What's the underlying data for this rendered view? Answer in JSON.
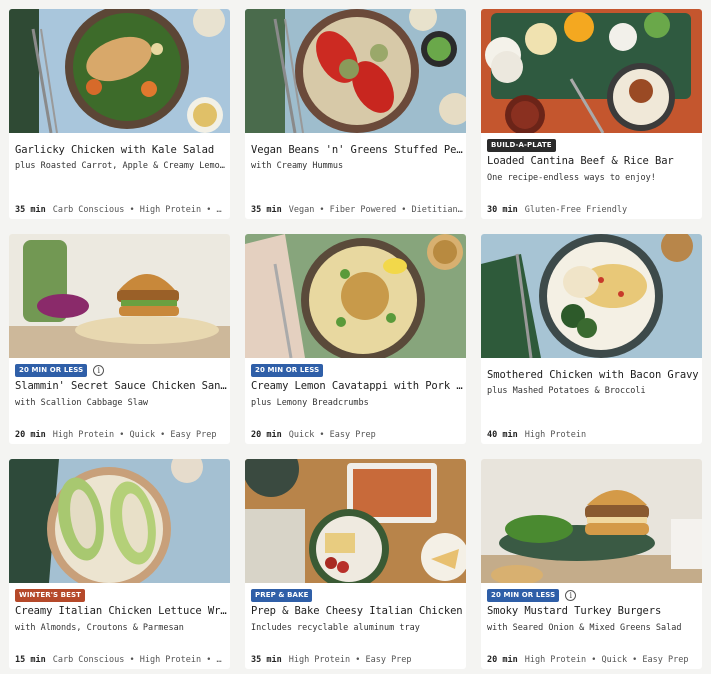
{
  "colors": {
    "badge_default": "#2b2b2b",
    "badge_quick": "#2f5fa8",
    "badge_winter": "#b5492a",
    "badge_prep": "#2f5fa8"
  },
  "recipes": [
    {
      "title": "Garlicky Chicken with Kale Salad",
      "subtitle": "plus Roasted Carrot, Apple & Creamy Lemon Fig Dressing",
      "time": "35 min",
      "tags": "Carb Conscious • High Protein • …",
      "badge": null,
      "photo": "chicken-kale-salad-photo"
    },
    {
      "title": "Vegan Beans 'n' Greens Stuffed Peppers",
      "subtitle": "with Creamy Hummus",
      "time": "35 min",
      "tags": "Vegan • Fiber Powered • Dietitian…",
      "badge": null,
      "photo": "stuffed-peppers-photo"
    },
    {
      "title": "Loaded Cantina Beef & Rice Bar",
      "subtitle": "One recipe-endless ways to enjoy!",
      "time": "30 min",
      "tags": "Gluten-Free Friendly",
      "badge": "BUILD-A-PLATE",
      "badge_color": "#2b2b2b",
      "info": false,
      "photo": "beef-rice-bar-photo"
    },
    {
      "title": "Slammin' Secret Sauce Chicken Sandwiches",
      "subtitle": "with Scallion Cabbage Slaw",
      "time": "20 min",
      "tags": "High Protein • Quick • Easy Prep",
      "badge": "20 MIN OR LESS",
      "badge_color": "#2f5fa8",
      "info": true,
      "photo": "chicken-sandwich-photo"
    },
    {
      "title": "Creamy Lemon Cavatappi with Pork & Peas",
      "subtitle": "plus Lemony Breadcrumbs",
      "time": "20 min",
      "tags": "Quick • Easy Prep",
      "badge": "20 MIN OR LESS",
      "badge_color": "#2f5fa8",
      "info": false,
      "photo": "cavatappi-photo"
    },
    {
      "title": "Smothered Chicken with Bacon Gravy",
      "subtitle": "plus Mashed Potatoes & Broccoli",
      "time": "40 min",
      "tags": "High Protein",
      "badge": null,
      "photo": "smothered-chicken-photo"
    },
    {
      "title": "Creamy Italian Chicken Lettuce Wraps",
      "subtitle": "with Almonds, Croutons & Parmesan",
      "time": "15 min",
      "tags": "Carb Conscious • High Protein • …",
      "badge": "WINTER'S BEST",
      "badge_color": "#b5492a",
      "info": false,
      "photo": "lettuce-wraps-photo"
    },
    {
      "title": "Prep & Bake Cheesy Italian Chicken",
      "subtitle": "Includes recyclable aluminum tray",
      "time": "35 min",
      "tags": "High Protein • Easy Prep",
      "badge": "PREP & BAKE",
      "badge_color": "#2f5fa8",
      "info": false,
      "photo": "cheesy-chicken-photo"
    },
    {
      "title": "Smoky Mustard Turkey Burgers",
      "subtitle": "with Seared Onion & Mixed Greens Salad",
      "time": "20 min",
      "tags": "High Protein • Quick • Easy Prep",
      "badge": "20 MIN OR LESS",
      "badge_color": "#2f5fa8",
      "info": true,
      "photo": "turkey-burger-photo"
    }
  ]
}
